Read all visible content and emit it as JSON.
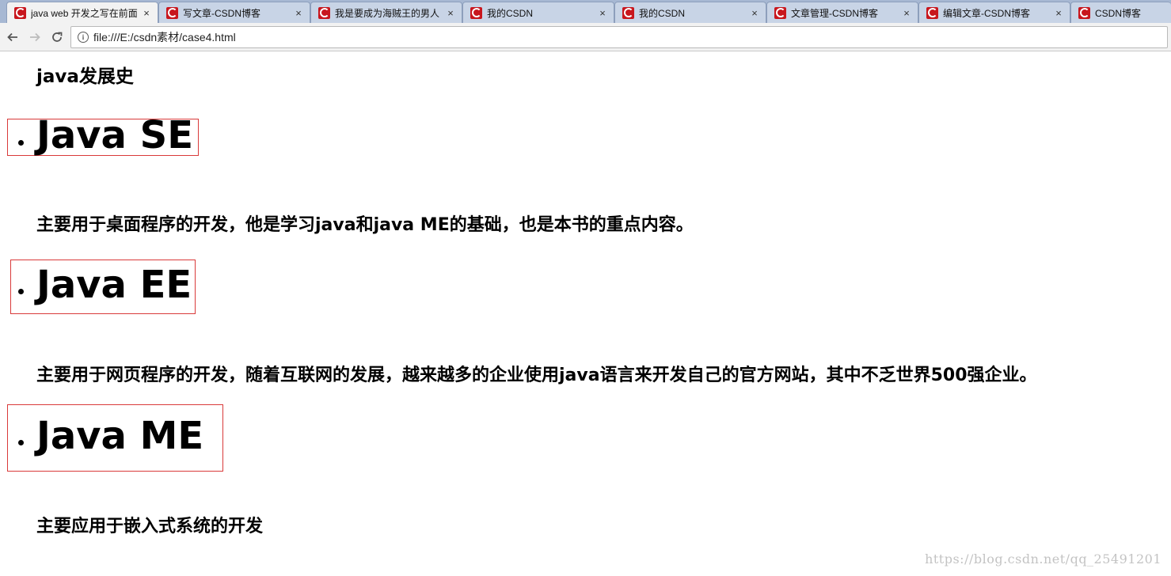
{
  "browser": {
    "tabs": [
      {
        "title": "java web 开发之写在前面",
        "active": true
      },
      {
        "title": "写文章-CSDN博客",
        "active": false
      },
      {
        "title": "我是要成为海贼王的男人",
        "active": false
      },
      {
        "title": "我的CSDN",
        "active": false
      },
      {
        "title": "我的CSDN",
        "active": false
      },
      {
        "title": "文章管理-CSDN博客",
        "active": false
      },
      {
        "title": "编辑文章-CSDN博客",
        "active": false
      },
      {
        "title": "CSDN博客",
        "active": false
      }
    ],
    "close_glyph": "×",
    "address": {
      "url": "file:///E:/csdn素材/case4.html",
      "info_glyph": "i"
    },
    "icons": {
      "back": "arrow-left-icon",
      "forward": "arrow-right-icon",
      "reload": "reload-icon",
      "favicon": "csdn-logo-icon"
    },
    "colors": {
      "tabstrip": "#a7b8d3",
      "favicon": "#c8161d"
    }
  },
  "page": {
    "heading": "java发展史",
    "editions": [
      {
        "title": "Java SE",
        "desc": "主要用于桌面程序的开发，他是学习java和java ME的基础，也是本书的重点内容。"
      },
      {
        "title": "Java EE",
        "desc": "主要用于网页程序的开发，随着互联网的发展，越来越多的企业使用java语言来开发自己的官方网站，其中不乏世界500强企业。"
      },
      {
        "title": "Java ME",
        "desc": "主要应用于嵌入式系统的开发"
      }
    ],
    "box_color": "#d93a3a",
    "watermark": "https://blog.csdn.net/qq_25491201"
  }
}
